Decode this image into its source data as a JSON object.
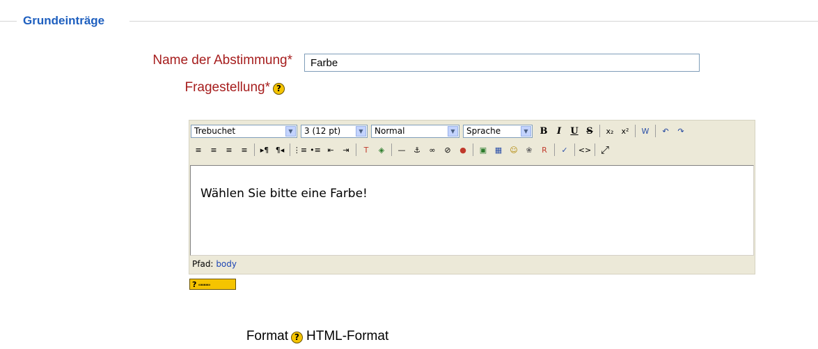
{
  "section": {
    "legend": "Grundeinträge"
  },
  "form": {
    "name_label": "Name der Abstimmung",
    "name_value": "Farbe",
    "question_label": "Fragestellung",
    "required_mark": "*",
    "help_glyph": "?"
  },
  "editor": {
    "font_select": "Trebuchet",
    "size_select": "3 (12 pt)",
    "style_select": "Normal",
    "lang_select": "Sprache",
    "toolbar_row1": [
      {
        "name": "bold-button",
        "glyph": "B"
      },
      {
        "name": "italic-button",
        "glyph": "I"
      },
      {
        "name": "underline-button",
        "glyph": "U"
      },
      {
        "name": "strikethrough-button",
        "glyph": "S"
      },
      {
        "name": "subscript-button",
        "glyph": "x₂"
      },
      {
        "name": "superscript-button",
        "glyph": "x²"
      },
      {
        "name": "clean-word-button",
        "glyph": "W"
      },
      {
        "name": "undo-button",
        "glyph": "↶"
      },
      {
        "name": "redo-button",
        "glyph": "↷"
      }
    ],
    "toolbar_row2": [
      {
        "name": "align-left-button",
        "glyph": "≡"
      },
      {
        "name": "align-center-button",
        "glyph": "≡"
      },
      {
        "name": "align-right-button",
        "glyph": "≡"
      },
      {
        "name": "justify-button",
        "glyph": "≡"
      },
      {
        "name": "ltr-button",
        "glyph": "▸¶"
      },
      {
        "name": "rtl-button",
        "glyph": "¶◂"
      },
      {
        "name": "ordered-list-button",
        "glyph": "⋮≡"
      },
      {
        "name": "unordered-list-button",
        "glyph": "•≡"
      },
      {
        "name": "outdent-button",
        "glyph": "⇤"
      },
      {
        "name": "indent-button",
        "glyph": "⇥"
      },
      {
        "name": "text-color-button",
        "glyph": "T"
      },
      {
        "name": "bg-color-button",
        "glyph": "◈"
      },
      {
        "name": "horizontal-rule-button",
        "glyph": "—"
      },
      {
        "name": "anchor-button",
        "glyph": "⚓"
      },
      {
        "name": "link-button",
        "glyph": "∞"
      },
      {
        "name": "unlink-button",
        "glyph": "⊘"
      },
      {
        "name": "nolink-button",
        "glyph": "●"
      },
      {
        "name": "image-button",
        "glyph": "▣"
      },
      {
        "name": "table-button",
        "glyph": "▦"
      },
      {
        "name": "smiley-button",
        "glyph": "☺"
      },
      {
        "name": "special-char-button",
        "glyph": "❀"
      },
      {
        "name": "search-replace-button",
        "glyph": "R"
      },
      {
        "name": "spellcheck-button",
        "glyph": "✓"
      },
      {
        "name": "html-source-button",
        "glyph": "<>"
      },
      {
        "name": "fullscreen-button",
        "glyph": "⤢"
      }
    ],
    "content": "Wählen Sie bitte eine Farbe!",
    "path_label": "Pfad:",
    "path_value": "body"
  },
  "format": {
    "label": "Format",
    "value": "HTML-Format"
  }
}
